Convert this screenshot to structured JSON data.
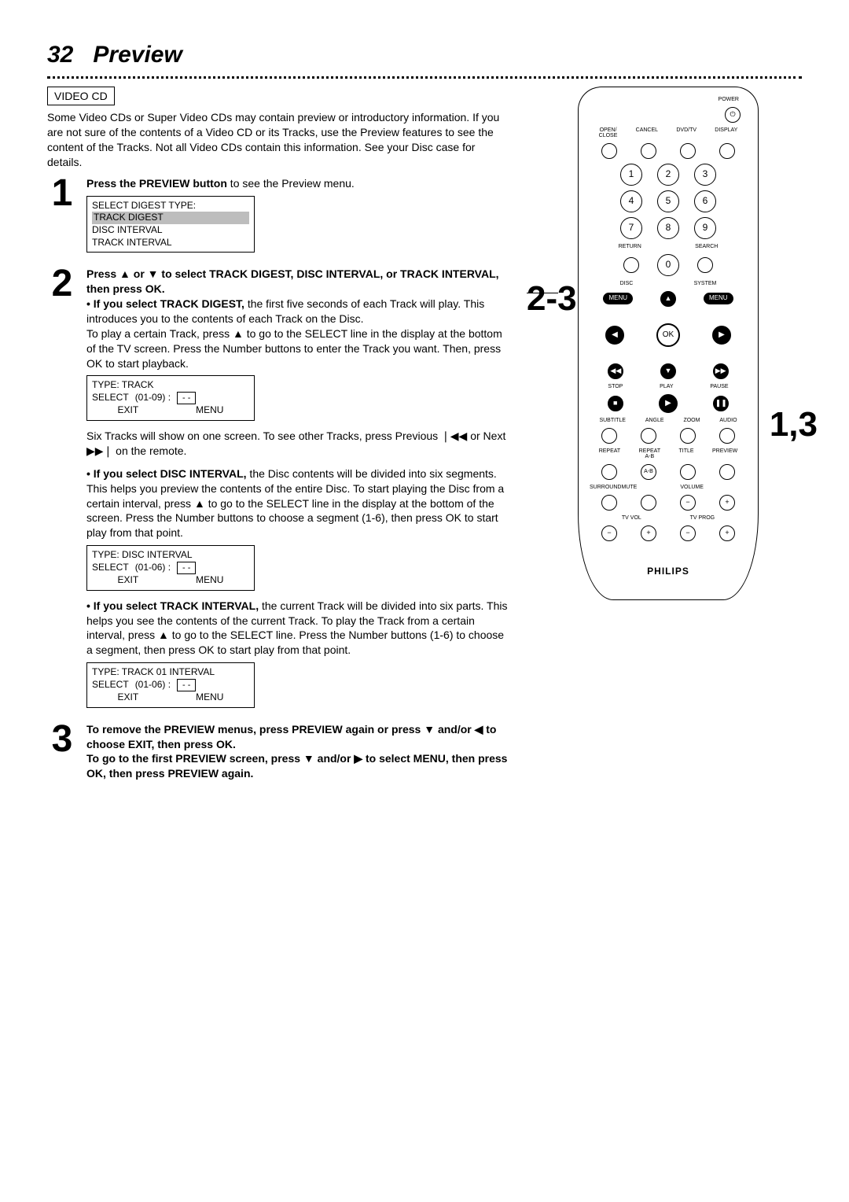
{
  "page": {
    "number": "32",
    "title": "Preview"
  },
  "badge": "VIDEO CD",
  "intro": "Some Video CDs or Super Video CDs may contain preview or introductory information. If you are not sure of the contents of a Video CD or its Tracks, use the Preview features to see the content of the Tracks. Not all Video CDs contain this information. See your Disc case for details.",
  "step1": {
    "text_a": "Press the PREVIEW button",
    "text_b": " to see the Preview menu.",
    "osd": {
      "l1": "SELECT DIGEST TYPE:",
      "l2": "TRACK DIGEST",
      "l3": "DISC INTERVAL",
      "l4": "TRACK INTERVAL"
    }
  },
  "step2": {
    "head": "Press ▲ or ▼ to select TRACK DIGEST, DISC INTERVAL, or TRACK INTERVAL, then press OK.",
    "td_bold": "• If you select TRACK DIGEST,",
    "td_rest": " the first five seconds of each Track will play. This introduces you to the contents of each Track on the Disc.",
    "td_play": "To play a certain Track, press ▲ to go to the SELECT line in the display at the bottom of the TV screen. Press the Number buttons to enter the Track you want. Then, press OK to start playback.",
    "osd_track": {
      "l1": "TYPE:  TRACK",
      "sel": "SELECT",
      "range": "(01-09) :",
      "val": "- -",
      "exit": "EXIT",
      "menu": "MENU"
    },
    "six": "Six Tracks will show on one screen. To see other Tracks, press Previous ",
    "six2": " or Next ",
    "six3": " on the remote.",
    "di_bold": "• If you select DISC INTERVAL,",
    "di_rest": " the Disc contents will be divided into six segments. This helps you preview the contents of the entire Disc.  To start playing the Disc from a certain interval, press ▲ to go to the SELECT line in the display at the bottom of the screen. Press the Number buttons to choose a segment (1-6), then press OK to start play from that point.",
    "osd_disc": {
      "l1": "TYPE:  DISC INTERVAL",
      "sel": "SELECT",
      "range": "(01-06) :",
      "val": "- -",
      "exit": "EXIT",
      "menu": "MENU"
    },
    "ti_bold": "• If you select TRACK INTERVAL,",
    "ti_rest": " the current Track will be divided into six parts. This helps you see the contents of the current Track. To play the Track from a certain interval, press ▲ to go to the SELECT line. Press the Number buttons (1-6) to choose a segment, then press OK to start play from that point.",
    "osd_ti": {
      "l1": "TYPE:  TRACK 01 INTERVAL",
      "sel": "SELECT",
      "range": "(01-06) :",
      "val": "- -",
      "exit": "EXIT",
      "menu": "MENU"
    }
  },
  "step3": {
    "l1": "To remove the PREVIEW menus, press PREVIEW again or press ▼ and/or ◀ to choose EXIT, then press OK.",
    "l2": "To go to the first PREVIEW screen, press ▼ and/or ▶ to select MENU, then press OK, then press PREVIEW again."
  },
  "callouts": {
    "a": "2-3",
    "b": "1,3"
  },
  "remote": {
    "power": "POWER",
    "row1": [
      "OPEN/\nCLOSE",
      "CANCEL",
      "DVD/TV",
      "DISPLAY"
    ],
    "num": [
      "1",
      "2",
      "3",
      "4",
      "5",
      "6",
      "7",
      "8",
      "9",
      "0"
    ],
    "return": "RETURN",
    "search": "SEARCH",
    "disc": "DISC",
    "system": "SYSTEM",
    "menu": "MENU",
    "ok": "OK",
    "stop": "STOP",
    "play": "PLAY",
    "pause": "PAUSE",
    "row_a": [
      "SUBTITLE",
      "ANGLE",
      "ZOOM",
      "AUDIO"
    ],
    "row_b": [
      "REPEAT",
      "REPEAT\nA-B",
      "TITLE",
      "PREVIEW"
    ],
    "row_c": [
      "SURROUND",
      "MUTE",
      "VOLUME"
    ],
    "tvvol": "TV VOL",
    "tvprog": "TV PROG",
    "brand": "PHILIPS"
  }
}
